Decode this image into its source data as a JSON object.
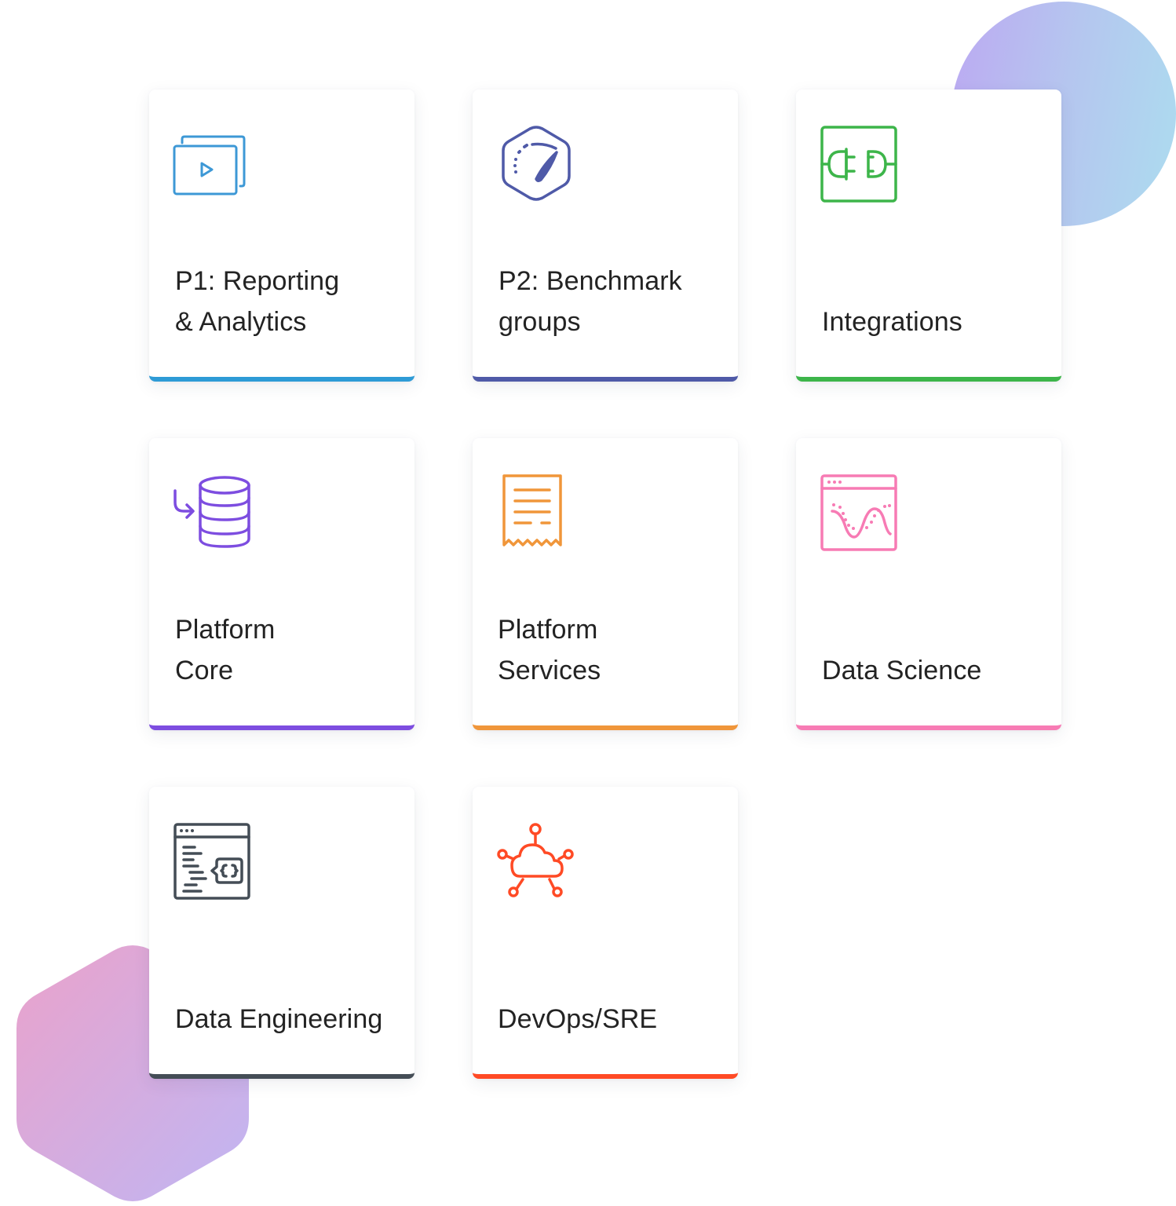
{
  "cards": [
    {
      "title_line1": "P1: Reporting",
      "title_line2": "& Analytics",
      "icon": "video-slides-icon",
      "accent": "#2e9bd6"
    },
    {
      "title_line1": "P2: Benchmark",
      "title_line2": "groups",
      "icon": "speedometer-hexagon-icon",
      "accent": "#4f5aa8"
    },
    {
      "title_line1": "",
      "title_line2": "Integrations",
      "icon": "plug-connector-icon",
      "accent": "#3db54a"
    },
    {
      "title_line1": "Platform",
      "title_line2": "Core",
      "icon": "database-import-icon",
      "accent": "#7d4de0"
    },
    {
      "title_line1": "Platform",
      "title_line2": "Services",
      "icon": "receipt-icon",
      "accent": "#f0963a"
    },
    {
      "title_line1": "",
      "title_line2": "Data Science",
      "icon": "chart-window-icon",
      "accent": "#f77bb4"
    },
    {
      "title_line1": "",
      "title_line2": "Data Engineering",
      "icon": "code-window-icon",
      "accent": "#444d56"
    },
    {
      "title_line1": "",
      "title_line2": "DevOps/SRE",
      "icon": "cloud-network-icon",
      "accent": "#ff4a25"
    }
  ],
  "colors": {
    "circle_gradient": [
      "#bca9f2",
      "#acdcef"
    ],
    "hexagon_gradient": [
      "#eaa2cb",
      "#c3b4f2"
    ]
  }
}
